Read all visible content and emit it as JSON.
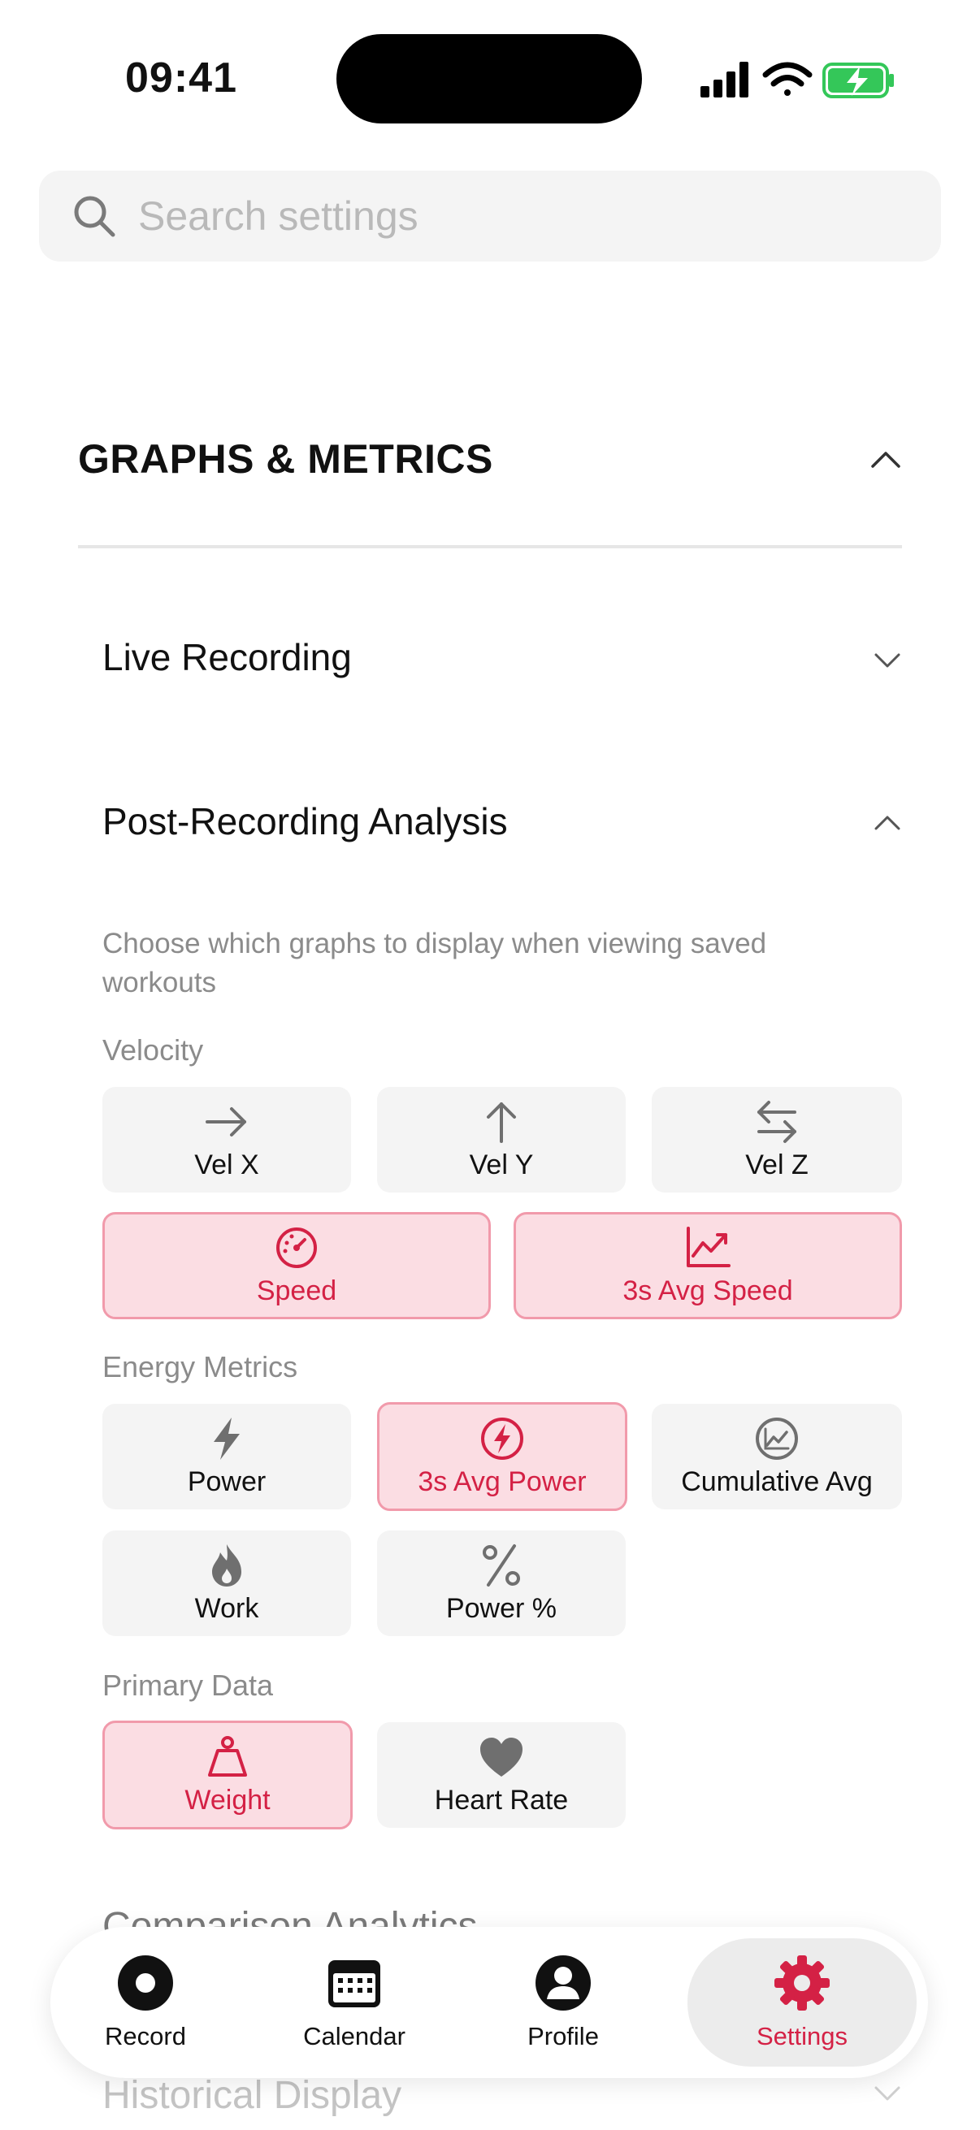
{
  "status": {
    "time": "09:41"
  },
  "search": {
    "placeholder": "Search settings"
  },
  "section": {
    "title": "GRAPHS & METRICS"
  },
  "live_recording": {
    "title": "Live Recording"
  },
  "post_recording": {
    "title": "Post-Recording Analysis",
    "description": "Choose which graphs to display when viewing saved workouts"
  },
  "groups": {
    "velocity": {
      "label": "Velocity",
      "items": [
        {
          "label": "Vel X",
          "icon": "arrow-right-icon",
          "selected": false
        },
        {
          "label": "Vel Y",
          "icon": "arrow-up-icon",
          "selected": false
        },
        {
          "label": "Vel Z",
          "icon": "arrows-left-right-icon",
          "selected": false
        },
        {
          "label": "Speed",
          "icon": "speedometer-icon",
          "selected": true
        },
        {
          "label": "3s Avg Speed",
          "icon": "trend-chart-icon",
          "selected": true
        }
      ]
    },
    "energy": {
      "label": "Energy Metrics",
      "items": [
        {
          "label": "Power",
          "icon": "bolt-icon",
          "selected": false
        },
        {
          "label": "3s Avg Power",
          "icon": "bolt-circle-icon",
          "selected": true
        },
        {
          "label": "Cumulative Avg",
          "icon": "chart-circle-icon",
          "selected": false
        },
        {
          "label": "Work",
          "icon": "flame-icon",
          "selected": false
        },
        {
          "label": "Power %",
          "icon": "percent-icon",
          "selected": false
        }
      ]
    },
    "primary": {
      "label": "Primary Data",
      "items": [
        {
          "label": "Weight",
          "icon": "weight-icon",
          "selected": true
        },
        {
          "label": "Heart Rate",
          "icon": "heart-icon",
          "selected": false
        }
      ]
    }
  },
  "more_sections": {
    "comparison": "Comparison Analytics",
    "historical": "Historical Display"
  },
  "nav": {
    "items": [
      {
        "label": "Record",
        "icon": "record-icon"
      },
      {
        "label": "Calendar",
        "icon": "calendar-icon"
      },
      {
        "label": "Profile",
        "icon": "profile-icon"
      },
      {
        "label": "Settings",
        "icon": "gear-icon"
      }
    ],
    "active": "Settings"
  },
  "colors": {
    "accent": "#d42145",
    "accent_bg": "#fbdde3",
    "accent_border": "#f19aab",
    "tile_bg": "#f4f4f4",
    "muted": "#8b8b8b",
    "battery": "#34c759"
  }
}
